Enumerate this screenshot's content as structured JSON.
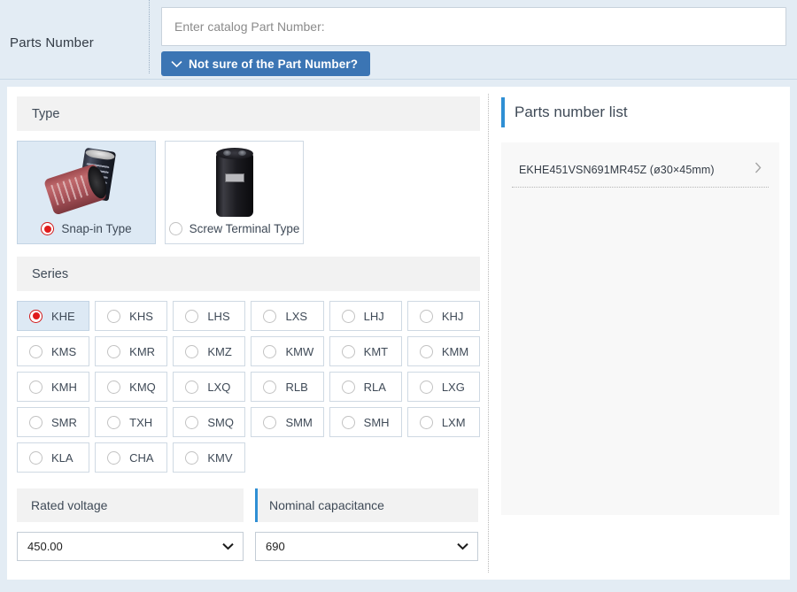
{
  "header": {
    "label": "Parts Number",
    "input_value": "",
    "input_placeholder": "Enter catalog Part Number:",
    "not_sure_button": "Not sure of the Part Number?"
  },
  "type_section": {
    "heading": "Type",
    "options": [
      {
        "label": "Snap-in Type",
        "selected": true,
        "icon": "snap-in-capacitor-image"
      },
      {
        "label": "Screw Terminal Type",
        "selected": false,
        "icon": "screw-terminal-capacitor-image"
      }
    ]
  },
  "series_section": {
    "heading": "Series",
    "options": [
      {
        "label": "KHE",
        "selected": true
      },
      {
        "label": "KHS",
        "selected": false
      },
      {
        "label": "LHS",
        "selected": false
      },
      {
        "label": "LXS",
        "selected": false
      },
      {
        "label": "LHJ",
        "selected": false
      },
      {
        "label": "KHJ",
        "selected": false
      },
      {
        "label": "KMS",
        "selected": false
      },
      {
        "label": "KMR",
        "selected": false
      },
      {
        "label": "KMZ",
        "selected": false
      },
      {
        "label": "KMW",
        "selected": false
      },
      {
        "label": "KMT",
        "selected": false
      },
      {
        "label": "KMM",
        "selected": false
      },
      {
        "label": "KMH",
        "selected": false
      },
      {
        "label": "KMQ",
        "selected": false
      },
      {
        "label": "LXQ",
        "selected": false
      },
      {
        "label": "RLB",
        "selected": false
      },
      {
        "label": "RLA",
        "selected": false
      },
      {
        "label": "LXG",
        "selected": false
      },
      {
        "label": "SMR",
        "selected": false
      },
      {
        "label": "TXH",
        "selected": false
      },
      {
        "label": "SMQ",
        "selected": false
      },
      {
        "label": "SMM",
        "selected": false
      },
      {
        "label": "SMH",
        "selected": false
      },
      {
        "label": "LXM",
        "selected": false
      },
      {
        "label": "KLA",
        "selected": false
      },
      {
        "label": "CHA",
        "selected": false
      },
      {
        "label": "KMV",
        "selected": false
      }
    ]
  },
  "rated_voltage": {
    "heading": "Rated voltage",
    "value": "450.00"
  },
  "nominal_capacitance": {
    "heading": "Nominal capacitance",
    "value": "690"
  },
  "parts_list": {
    "title": "Parts number list",
    "items": [
      {
        "label": "EKHE451VSN691MR45Z (ø30×45mm)"
      }
    ]
  },
  "colors": {
    "page_bg": "#e3ecf4",
    "panel_bg": "#ffffff",
    "accent_blue": "#2f8fd4",
    "button_blue": "#3b75b4",
    "selected_item_bg": "#dde9f4",
    "radio_selected": "#e01b1b",
    "section_head_bg": "#f2f2f2",
    "list_bg": "#f8f8f8"
  }
}
